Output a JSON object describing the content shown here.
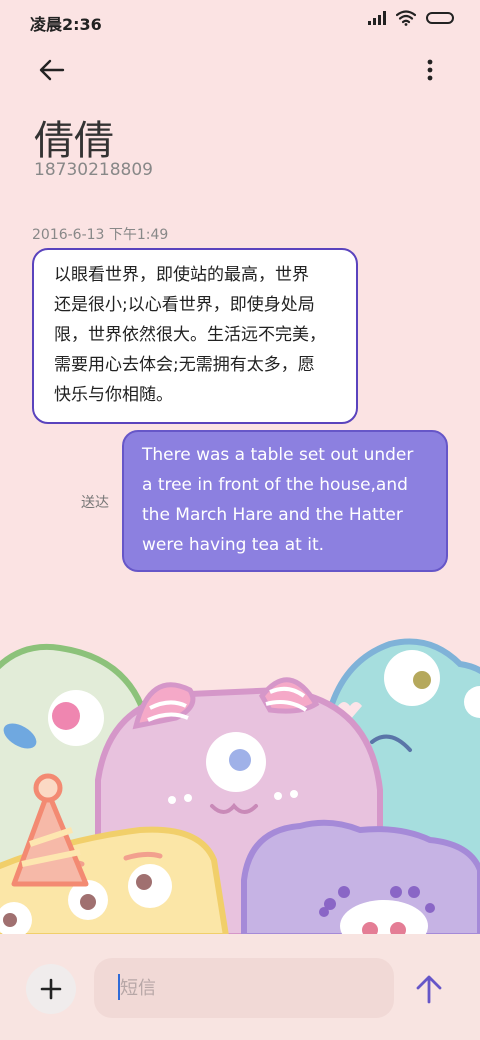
{
  "status_bar": {
    "time": "凌晨2:36"
  },
  "header": {
    "back_icon": "arrow-left-icon",
    "more_icon": "more-vertical-icon"
  },
  "contact": {
    "name": "倩倩",
    "number": "18730218809"
  },
  "conversation": {
    "date": "2016-6-13 下午1:49",
    "incoming": {
      "lines": [
        "以眼看世界，即使站的最高，世界",
        "还是很小;以心看世界，即使身处局",
        "限，世界依然很大。生活远不完美，",
        "需要用心去体会;无需拥有太多，愿",
        "快乐与你相随。"
      ]
    },
    "outgoing": {
      "lines": [
        "There was a table set out under",
        "a tree in front of the house,and",
        "the March Hare and the Hatter",
        "were having tea at it."
      ],
      "status": "送达"
    }
  },
  "composer": {
    "placeholder": "短信",
    "add_icon": "plus-icon",
    "send_icon": "arrow-up-icon"
  },
  "colors": {
    "background": "#fbe3e3",
    "incoming_border": "#5a43bd",
    "outgoing_bubble": "#8c80e0"
  }
}
